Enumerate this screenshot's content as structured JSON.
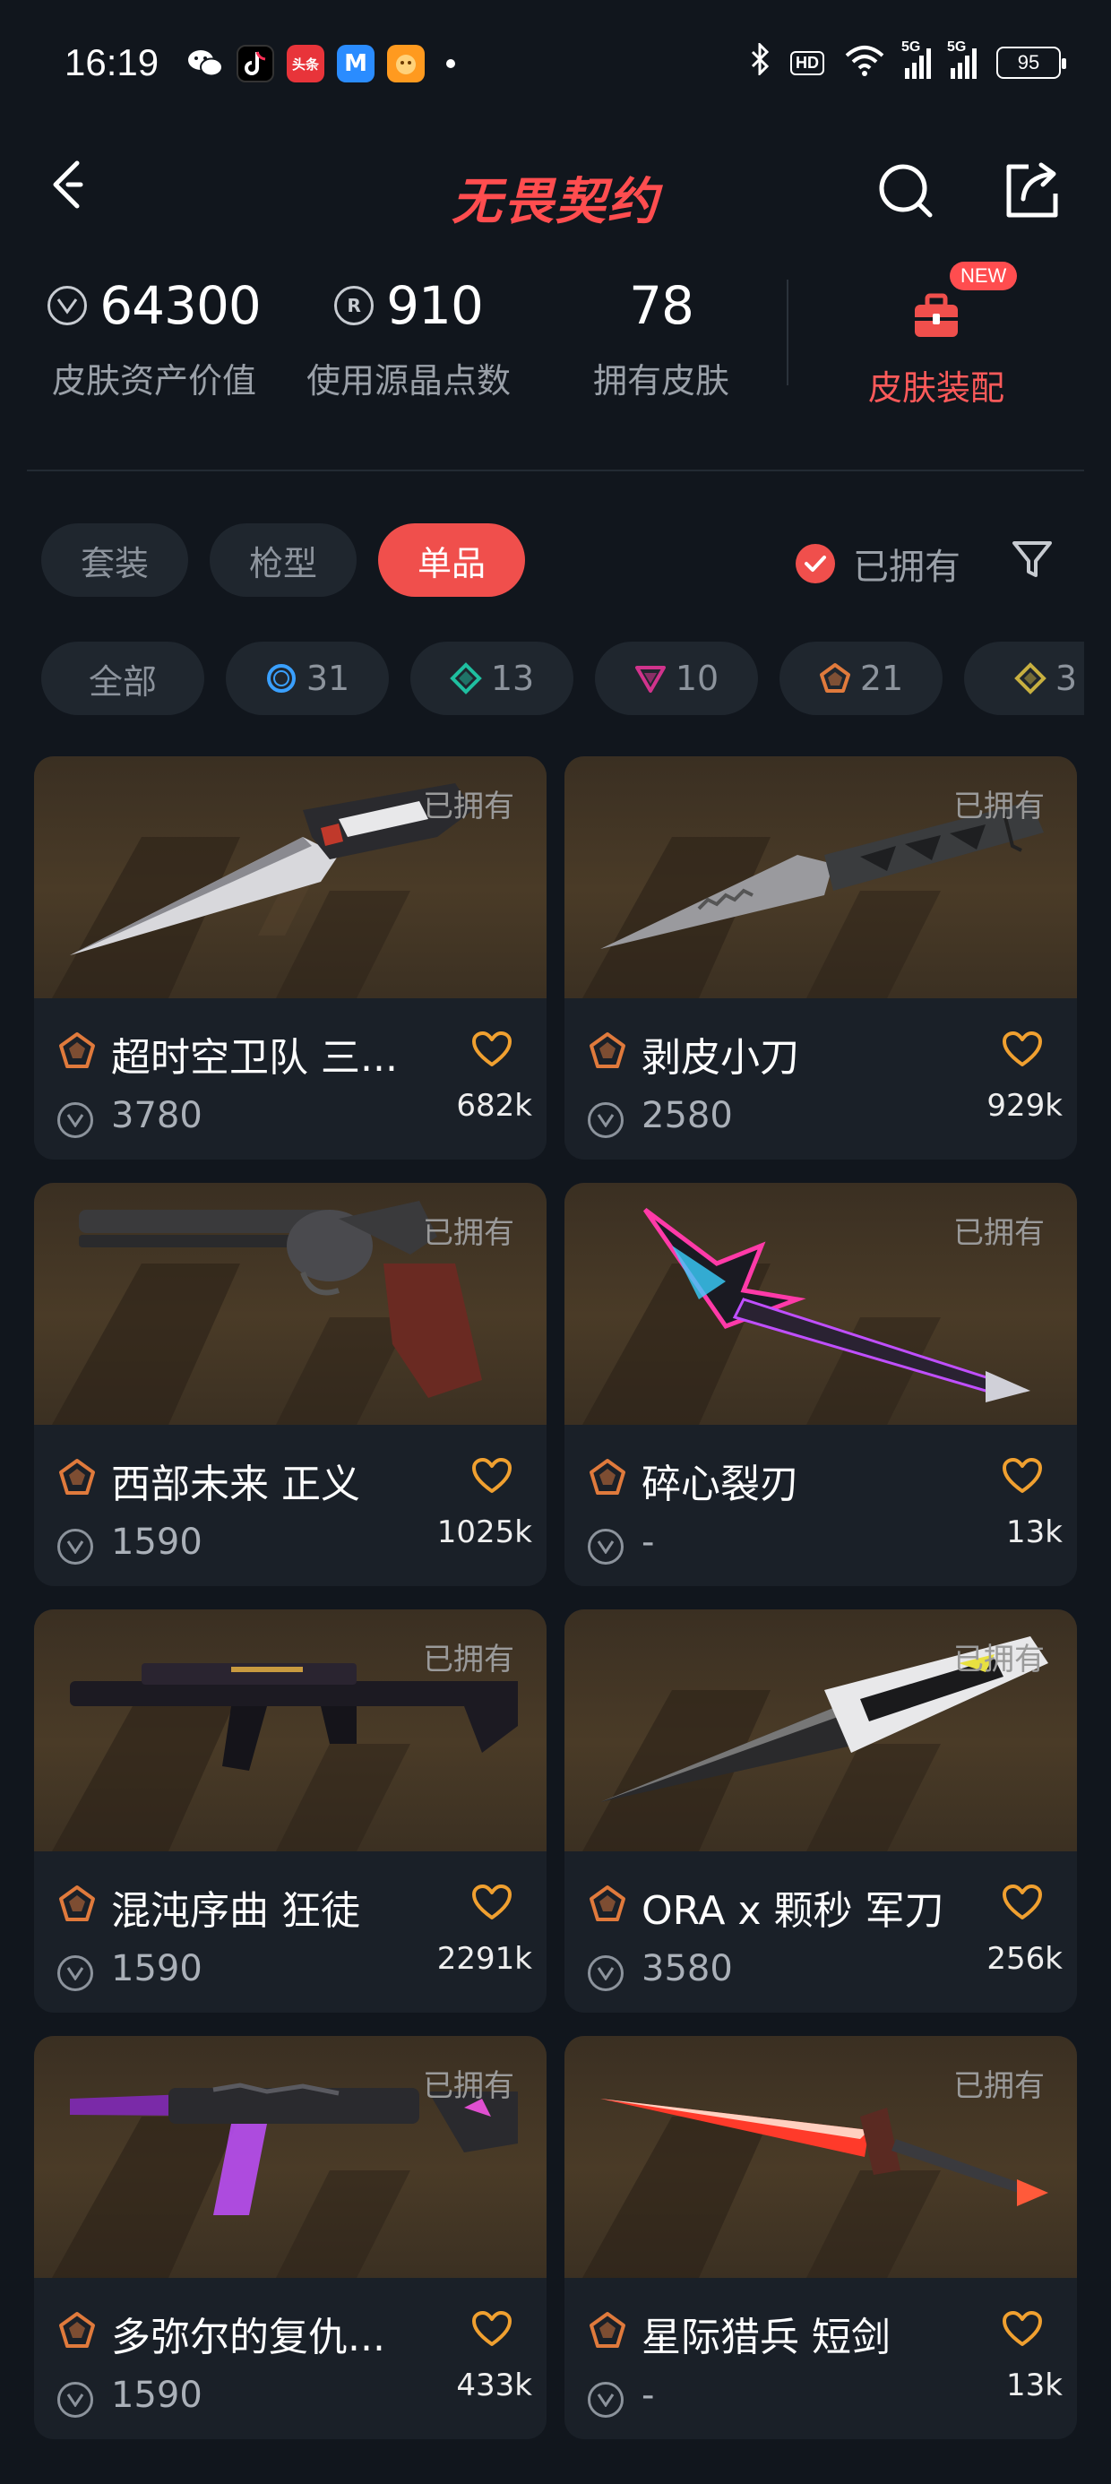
{
  "status_bar": {
    "time": "16:19",
    "apps": [
      "wechat-icon",
      "douyin-icon",
      "toutiao-icon",
      "m-app-icon",
      "orange-app-icon"
    ],
    "toutiao_label": "头条",
    "hd_label": "HD",
    "signal1_label": "5G",
    "signal2_label": "5G",
    "battery": "95"
  },
  "header": {
    "title": "无畏契约"
  },
  "stats": {
    "asset_value": "64300",
    "asset_label": "皮肤资产价值",
    "crystal_points": "910",
    "crystal_label": "使用源晶点数",
    "skins_owned": "78",
    "skins_label": "拥有皮肤",
    "outfit_label": "皮肤装配",
    "new_badge": "NEW",
    "crystal_icon_letter": "R"
  },
  "tabs": [
    {
      "label": "套装",
      "active": false
    },
    {
      "label": "枪型",
      "active": false
    },
    {
      "label": "单品",
      "active": true
    }
  ],
  "owned_filter": {
    "label": "已拥有",
    "checked": true
  },
  "chips": [
    {
      "label": "全部",
      "glyph": "none"
    },
    {
      "label": "31",
      "glyph": "select-tier",
      "color": "#3aa0ff"
    },
    {
      "label": "13",
      "glyph": "deluxe-tier",
      "color": "#1fbfa0"
    },
    {
      "label": "10",
      "glyph": "premium-tier",
      "color": "#d0338c"
    },
    {
      "label": "21",
      "glyph": "exclusive-tier",
      "color": "#e07a3c"
    },
    {
      "label": "3",
      "glyph": "ultra-tier",
      "color": "#c8b040"
    }
  ],
  "cards": [
    {
      "name": "超时空卫队 三...",
      "price": "3780",
      "likes": "682k",
      "owned": "已拥有",
      "weapon": "knife-silver"
    },
    {
      "name": "剥皮小刀",
      "price": "2580",
      "likes": "929k",
      "owned": "已拥有",
      "weapon": "knife-combat"
    },
    {
      "name": "西部未来 正义",
      "price": "1590",
      "likes": "1025k",
      "owned": "已拥有",
      "weapon": "revolver"
    },
    {
      "name": "碎心裂刃",
      "price": "-",
      "likes": "13k",
      "owned": "已拥有",
      "weapon": "knife-neon"
    },
    {
      "name": "混沌序曲 狂徒",
      "price": "1590",
      "likes": "2291k",
      "owned": "已拥有",
      "weapon": "rifle-dark"
    },
    {
      "name": "ORA x 颗秒 军刀",
      "price": "3580",
      "likes": "256k",
      "owned": "已拥有",
      "weapon": "machete"
    },
    {
      "name": "多弥尔的复仇...",
      "price": "1590",
      "likes": "433k",
      "owned": "已拥有",
      "weapon": "rifle-purple"
    },
    {
      "name": "星际猎兵 短剑",
      "price": "-",
      "likes": "13k",
      "owned": "已拥有",
      "weapon": "sword-red"
    }
  ]
}
